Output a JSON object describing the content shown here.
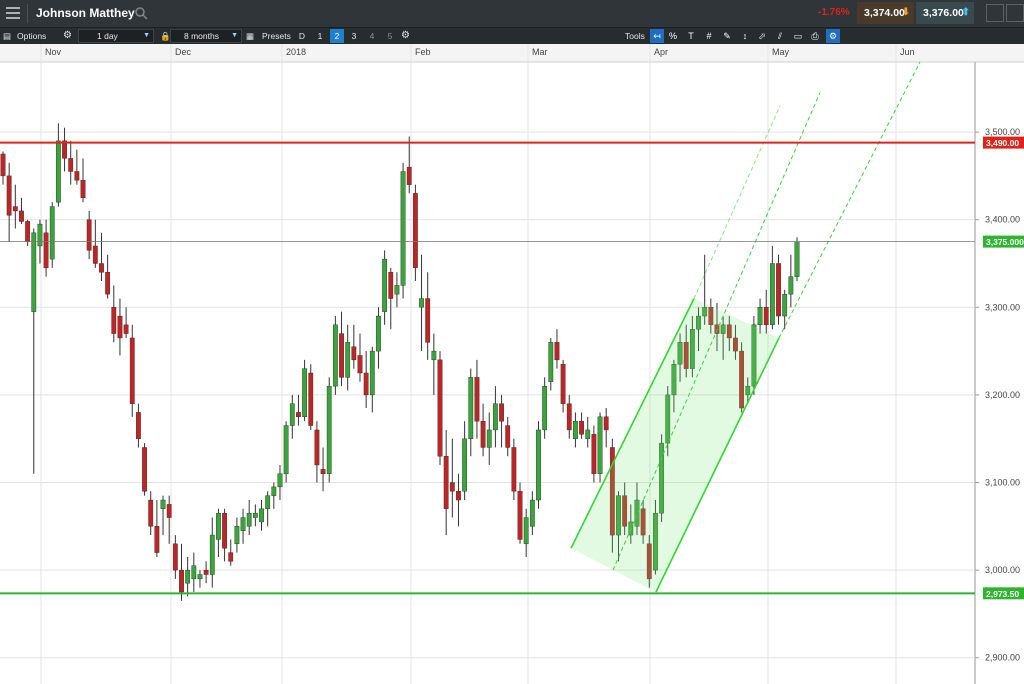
{
  "app": {
    "instrument": "Johnson Matthey",
    "change_pct": "-1.76%",
    "sell_price": "3,374.00",
    "buy_price": "3,376.00"
  },
  "toolbar": {
    "options_label": "Options",
    "interval_value": "1 day",
    "range_value": "8 months",
    "presets_label": "Presets",
    "presets": [
      "D",
      "1",
      "2",
      "3",
      "4",
      "5"
    ],
    "active_preset": "2",
    "tools_label": "Tools",
    "tool_icons": [
      "back-arrow-icon",
      "percent-icon",
      "text-size-icon",
      "crosshair-icon",
      "draw-icon",
      "price-marker-icon",
      "trendline-icon",
      "channel-icon",
      "shape-icon",
      "print-icon",
      "settings-icon"
    ]
  },
  "chart_data": {
    "type": "candlestick",
    "x_tick_labels": [
      "Nov",
      "Dec",
      "2018",
      "Feb",
      "Mar",
      "Apr",
      "May",
      "Jun"
    ],
    "y_tick_labels": [
      "3,500.00",
      "3,400.00",
      "3,300.00",
      "3,200.00",
      "3,100.00",
      "3,000.00",
      "2,900.00"
    ],
    "y_ticks": [
      3500,
      3400,
      3300,
      3200,
      3100,
      3000,
      2900
    ],
    "ylim": [
      2870,
      3580
    ],
    "resistance_level": {
      "value": 3488,
      "label": "3,490.00",
      "color": "#e0221b"
    },
    "support_level": {
      "value": 2973.5,
      "label": "2,973.50",
      "color": "#2db52d"
    },
    "current_price": {
      "value": 3375,
      "label": "3,375.000",
      "color": "#2db52d"
    },
    "grid": true,
    "candles": [
      [
        3475,
        3478,
        3440,
        3450
      ],
      [
        3450,
        3465,
        3375,
        3405
      ],
      [
        3415,
        3440,
        3390,
        3410
      ],
      [
        3410,
        3425,
        3395,
        3398
      ],
      [
        3398,
        3400,
        3370,
        3375
      ],
      [
        3295,
        3390,
        3110,
        3385
      ],
      [
        3370,
        3400,
        3350,
        3395
      ],
      [
        3385,
        3400,
        3335,
        3345
      ],
      [
        3355,
        3420,
        3345,
        3415
      ],
      [
        3420,
        3510,
        3415,
        3490
      ],
      [
        3490,
        3505,
        3455,
        3470
      ],
      [
        3470,
        3490,
        3440,
        3455
      ],
      [
        3455,
        3480,
        3440,
        3445
      ],
      [
        3445,
        3470,
        3420,
        3425
      ],
      [
        3400,
        3410,
        3355,
        3365
      ],
      [
        3370,
        3400,
        3345,
        3350
      ],
      [
        3350,
        3385,
        3330,
        3340
      ],
      [
        3340,
        3360,
        3310,
        3315
      ],
      [
        3300,
        3325,
        3260,
        3270
      ],
      [
        3290,
        3310,
        3245,
        3265
      ],
      [
        3280,
        3300,
        3265,
        3270
      ],
      [
        3265,
        3280,
        3175,
        3190
      ],
      [
        3180,
        3190,
        3140,
        3150
      ],
      [
        3140,
        3145,
        3085,
        3090
      ],
      [
        3080,
        3090,
        3040,
        3050
      ],
      [
        3050,
        3080,
        3015,
        3020
      ],
      [
        3070,
        3085,
        3040,
        3080
      ],
      [
        3075,
        3085,
        3030,
        3060
      ],
      [
        3030,
        3040,
        2990,
        3000
      ],
      [
        3000,
        3030,
        2965,
        2975
      ],
      [
        2985,
        3015,
        2970,
        3000
      ],
      [
        2990,
        3020,
        2975,
        3005
      ],
      [
        2990,
        3000,
        2980,
        2995
      ],
      [
        3000,
        3010,
        2985,
        2995
      ],
      [
        2995,
        3060,
        2980,
        3040
      ],
      [
        3035,
        3070,
        3015,
        3065
      ],
      [
        3065,
        3070,
        3010,
        3025
      ],
      [
        3020,
        3035,
        3005,
        3010
      ],
      [
        3030,
        3060,
        3020,
        3050
      ],
      [
        3045,
        3070,
        3030,
        3060
      ],
      [
        3050,
        3080,
        3040,
        3065
      ],
      [
        3060,
        3075,
        3050,
        3065
      ],
      [
        3055,
        3080,
        3045,
        3070
      ],
      [
        3070,
        3090,
        3050,
        3085
      ],
      [
        3085,
        3100,
        3070,
        3095
      ],
      [
        3095,
        3120,
        3080,
        3110
      ],
      [
        3110,
        3170,
        3100,
        3165
      ],
      [
        3165,
        3200,
        3150,
        3190
      ],
      [
        3180,
        3200,
        3165,
        3175
      ],
      [
        3175,
        3240,
        3170,
        3230
      ],
      [
        3225,
        3235,
        3160,
        3165
      ],
      [
        3160,
        3170,
        3100,
        3120
      ],
      [
        3115,
        3140,
        3090,
        3110
      ],
      [
        3110,
        3220,
        3100,
        3210
      ],
      [
        3210,
        3290,
        3200,
        3280
      ],
      [
        3270,
        3295,
        3210,
        3220
      ],
      [
        3220,
        3280,
        3205,
        3260
      ],
      [
        3255,
        3280,
        3230,
        3240
      ],
      [
        3245,
        3270,
        3215,
        3225
      ],
      [
        3225,
        3250,
        3185,
        3200
      ],
      [
        3200,
        3255,
        3180,
        3250
      ],
      [
        3250,
        3300,
        3230,
        3290
      ],
      [
        3295,
        3365,
        3280,
        3355
      ],
      [
        3340,
        3345,
        3275,
        3310
      ],
      [
        3315,
        3340,
        3300,
        3325
      ],
      [
        3325,
        3465,
        3310,
        3455
      ],
      [
        3460,
        3495,
        3430,
        3440
      ],
      [
        3430,
        3440,
        3330,
        3345
      ],
      [
        3300,
        3360,
        3250,
        3310
      ],
      [
        3310,
        3340,
        3240,
        3260
      ],
      [
        3240,
        3270,
        3200,
        3250
      ],
      [
        3240,
        3250,
        3120,
        3130
      ],
      [
        3130,
        3160,
        3040,
        3070
      ],
      [
        3100,
        3150,
        3060,
        3090
      ],
      [
        3090,
        3110,
        3050,
        3080
      ],
      [
        3090,
        3170,
        3080,
        3150
      ],
      [
        3150,
        3230,
        3130,
        3220
      ],
      [
        3220,
        3240,
        3150,
        3170
      ],
      [
        3170,
        3190,
        3130,
        3140
      ],
      [
        3140,
        3180,
        3120,
        3160
      ],
      [
        3160,
        3210,
        3140,
        3190
      ],
      [
        3190,
        3200,
        3140,
        3170
      ],
      [
        3165,
        3175,
        3130,
        3140
      ],
      [
        3140,
        3150,
        3080,
        3090
      ],
      [
        3090,
        3100,
        3030,
        3035
      ],
      [
        3030,
        3070,
        3015,
        3060
      ],
      [
        3050,
        3090,
        3040,
        3080
      ],
      [
        3080,
        3170,
        3070,
        3160
      ],
      [
        3160,
        3220,
        3150,
        3210
      ],
      [
        3215,
        3265,
        3205,
        3260
      ],
      [
        3260,
        3275,
        3230,
        3240
      ],
      [
        3235,
        3240,
        3180,
        3190
      ],
      [
        3190,
        3200,
        3150,
        3160
      ],
      [
        3150,
        3180,
        3140,
        3170
      ],
      [
        3170,
        3180,
        3150,
        3155
      ],
      [
        3150,
        3175,
        3140,
        3160
      ],
      [
        3155,
        3165,
        3100,
        3110
      ],
      [
        3110,
        3180,
        3100,
        3175
      ],
      [
        3175,
        3185,
        3140,
        3160
      ],
      [
        3140,
        3150,
        3020,
        3040
      ],
      [
        3040,
        3090,
        3010,
        3085
      ],
      [
        3085,
        3100,
        3040,
        3050
      ],
      [
        3040,
        3075,
        3030,
        3055
      ],
      [
        3050,
        3100,
        3040,
        3080
      ],
      [
        3070,
        3080,
        3030,
        3040
      ],
      [
        3030,
        3040,
        2980,
        2990
      ],
      [
        3000,
        3080,
        2995,
        3065
      ],
      [
        3065,
        3155,
        3055,
        3145
      ],
      [
        3145,
        3210,
        3130,
        3200
      ],
      [
        3200,
        3240,
        3180,
        3235
      ],
      [
        3235,
        3270,
        3215,
        3260
      ],
      [
        3260,
        3280,
        3220,
        3230
      ],
      [
        3230,
        3290,
        3220,
        3275
      ],
      [
        3275,
        3300,
        3250,
        3290
      ],
      [
        3290,
        3360,
        3280,
        3300
      ],
      [
        3300,
        3310,
        3270,
        3280
      ],
      [
        3280,
        3305,
        3250,
        3270
      ],
      [
        3270,
        3290,
        3240,
        3280
      ],
      [
        3280,
        3290,
        3250,
        3265
      ],
      [
        3265,
        3280,
        3240,
        3250
      ],
      [
        3250,
        3260,
        3180,
        3185
      ],
      [
        3200,
        3220,
        3190,
        3210
      ],
      [
        3210,
        3290,
        3200,
        3280
      ],
      [
        3280,
        3310,
        3270,
        3300
      ],
      [
        3300,
        3320,
        3270,
        3280
      ],
      [
        3280,
        3370,
        3275,
        3350
      ],
      [
        3350,
        3360,
        3280,
        3290
      ],
      [
        3290,
        3320,
        3275,
        3315
      ],
      [
        3315,
        3360,
        3300,
        3335
      ],
      [
        3335,
        3380,
        3330,
        3375
      ]
    ],
    "up_color": "#3aa53a",
    "down_color": "#c02525"
  }
}
